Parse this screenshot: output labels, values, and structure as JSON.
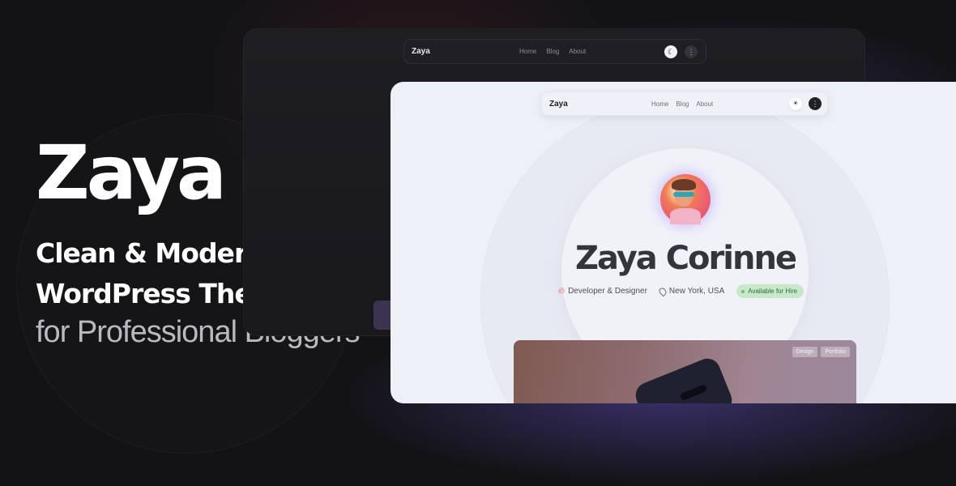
{
  "hero": {
    "brand": "Zaya",
    "tagline_line1": "Clean & Modern",
    "tagline_line2": "WordPress Theme",
    "tagline_line3": "for Professional Bloggers"
  },
  "dark_preview": {
    "logo": "Zaya",
    "nav": [
      "Home",
      "Blog",
      "About"
    ],
    "theme_toggle_icon": "moon-icon",
    "menu_icon": "more-icon"
  },
  "light_preview": {
    "logo": "Zaya",
    "nav": [
      "Home",
      "Blog",
      "About"
    ],
    "theme_toggle_icon": "sun-icon",
    "menu_icon": "more-icon",
    "profile": {
      "name": "Zaya Corinne",
      "role": "Developer & Designer",
      "location": "New York, USA",
      "availability": "Available for Hire"
    },
    "post": {
      "tags": [
        "Design",
        "Portfolio"
      ]
    }
  },
  "colors": {
    "background": "#131316",
    "accent_glow": "#5846aa",
    "available_badge": "#c8e8cc"
  }
}
